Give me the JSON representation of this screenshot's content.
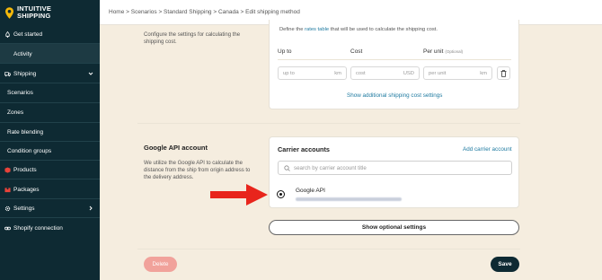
{
  "brand": {
    "line1": "INTUITIVE",
    "line2": "SHIPPING"
  },
  "sidebar": {
    "items": [
      {
        "label": "Get started",
        "icon": "rocket-icon"
      },
      {
        "label": "Activity",
        "icon": ""
      },
      {
        "label": "Shipping",
        "icon": "truck-icon"
      },
      {
        "label": "Scenarios"
      },
      {
        "label": "Zones"
      },
      {
        "label": "Rate blending"
      },
      {
        "label": "Condition groups"
      },
      {
        "label": "Products",
        "icon": "box-icon"
      },
      {
        "label": "Packages",
        "icon": "package-icon"
      },
      {
        "label": "Settings",
        "icon": "gear-icon"
      },
      {
        "label": "Shopify connection",
        "icon": "link-icon"
      }
    ]
  },
  "breadcrumb": "Home > Scenarios > Standard Shipping > Canada > Edit shipping method",
  "shipping_cost": {
    "description": "Configure the settings for calculating the shipping cost.",
    "rates_intro_before": "Define the",
    "rates_link": "rates table",
    "rates_intro_after": "that will be used to calculate the shipping cost.",
    "col_up_to": "Up to",
    "col_cost": "Cost",
    "col_per_unit": "Per unit",
    "col_per_unit_optional": "(Optional)",
    "up_to_placeholder": "up to",
    "up_to_unit": "km",
    "cost_placeholder": "cost",
    "cost_unit": "USD",
    "per_unit_placeholder": "per unit",
    "per_unit_unit": "km",
    "show_additional": "Show additional shipping cost settings"
  },
  "google_api": {
    "title": "Google API account",
    "description": "We utilize the Google API to calculate the distance from the ship from origin address to the delivery address.",
    "carrier_accounts_title": "Carrier accounts",
    "add_carrier": "Add carrier account",
    "search_placeholder": "search by carrier account title",
    "account_name": "Google API",
    "show_optional": "Show optional settings"
  },
  "footer": {
    "delete_label": "Delete",
    "save_label": "Save"
  },
  "colors": {
    "sidebar": "#0e2a33",
    "accent_link": "#1e7aa0",
    "arrow": "#e8251c",
    "delete": "#f1a29b",
    "page_bg": "#f5eddf"
  }
}
